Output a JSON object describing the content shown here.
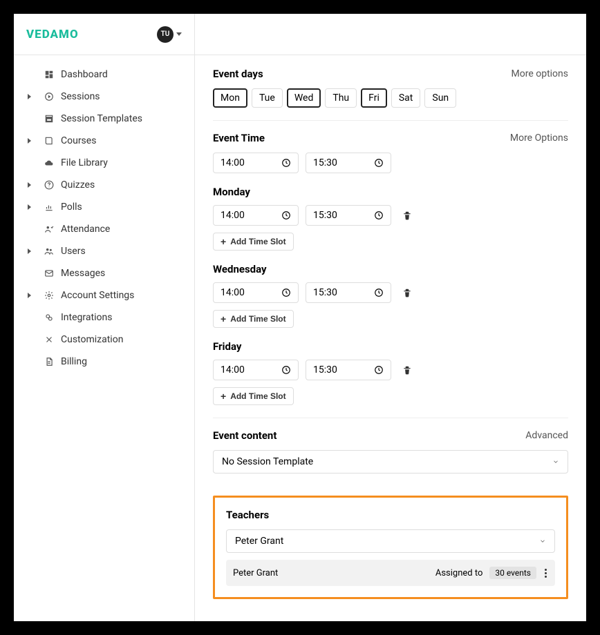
{
  "brand": "VEDAMO",
  "user_initials": "TU",
  "sidebar": {
    "items": [
      {
        "label": "Dashboard",
        "expandable": false,
        "icon": "dashboard"
      },
      {
        "label": "Sessions",
        "expandable": true,
        "icon": "play"
      },
      {
        "label": "Session Templates",
        "expandable": false,
        "icon": "template"
      },
      {
        "label": "Courses",
        "expandable": true,
        "icon": "book"
      },
      {
        "label": "File Library",
        "expandable": false,
        "icon": "cloud"
      },
      {
        "label": "Quizzes",
        "expandable": true,
        "icon": "question"
      },
      {
        "label": "Polls",
        "expandable": true,
        "icon": "chart"
      },
      {
        "label": "Attendance",
        "expandable": false,
        "icon": "attend"
      },
      {
        "label": "Users",
        "expandable": true,
        "icon": "users"
      },
      {
        "label": "Messages",
        "expandable": false,
        "icon": "mail"
      },
      {
        "label": "Account Settings",
        "expandable": true,
        "icon": "gear"
      },
      {
        "label": "Integrations",
        "expandable": false,
        "icon": "plug"
      },
      {
        "label": "Customization",
        "expandable": false,
        "icon": "tools"
      },
      {
        "label": "Billing",
        "expandable": false,
        "icon": "doc"
      }
    ]
  },
  "event_days": {
    "title": "Event days",
    "more": "More options",
    "days": [
      {
        "label": "Mon",
        "selected": true
      },
      {
        "label": "Tue",
        "selected": false
      },
      {
        "label": "Wed",
        "selected": true
      },
      {
        "label": "Thu",
        "selected": false
      },
      {
        "label": "Fri",
        "selected": true
      },
      {
        "label": "Sat",
        "selected": false
      },
      {
        "label": "Sun",
        "selected": false
      }
    ]
  },
  "event_time": {
    "title": "Event Time",
    "more": "More Options",
    "start": "14:00",
    "end": "15:30"
  },
  "day_slots": [
    {
      "day": "Monday",
      "start": "14:00",
      "end": "15:30",
      "add_label": "Add Time Slot"
    },
    {
      "day": "Wednesday",
      "start": "14:00",
      "end": "15:30",
      "add_label": "Add Time Slot"
    },
    {
      "day": "Friday",
      "start": "14:00",
      "end": "15:30",
      "add_label": "Add Time Slot"
    }
  ],
  "event_content": {
    "title": "Event content",
    "advanced": "Advanced",
    "template": "No Session Template"
  },
  "teachers": {
    "title": "Teachers",
    "selected": "Peter Grant",
    "row_name": "Peter Grant",
    "assigned_label": "Assigned to",
    "assigned_count": "30 events"
  }
}
